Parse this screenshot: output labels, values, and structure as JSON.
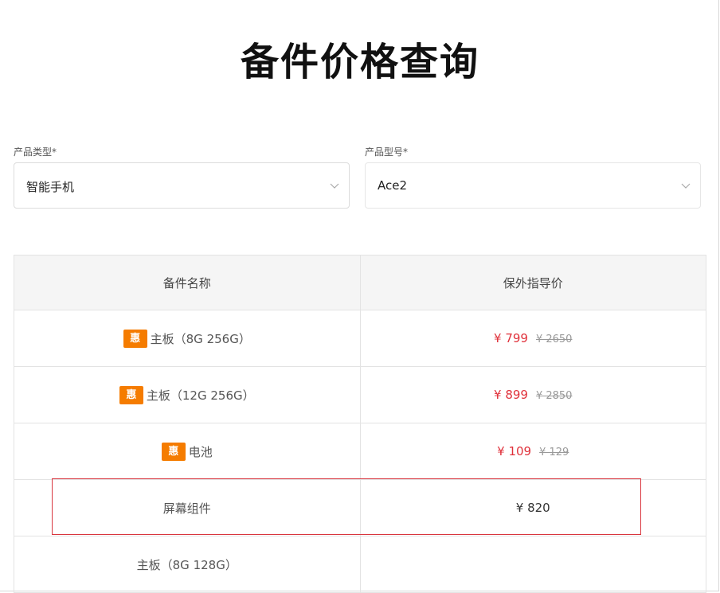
{
  "page": {
    "title": "备件价格查询"
  },
  "filters": {
    "product_type": {
      "label": "产品类型*",
      "value": "智能手机",
      "icon": "chevron-down-icon"
    },
    "product_model": {
      "label": "产品型号*",
      "value": "Ace2",
      "icon": "chevron-down-icon"
    }
  },
  "table": {
    "headers": [
      "备件名称",
      "保外指导价"
    ],
    "rows": [
      {
        "badge": "惠",
        "name": "主板（8G 256G）",
        "price": "¥ 799",
        "original_price": "¥ 2650"
      },
      {
        "badge": "惠",
        "name": "主板（12G 256G）",
        "price": "¥ 899",
        "original_price": "¥ 2850"
      },
      {
        "badge": "惠",
        "name": "电池",
        "price": "¥ 109",
        "original_price": "¥ 129"
      },
      {
        "badge": "",
        "name": "屏幕组件",
        "price": "¥ 820",
        "original_price": ""
      },
      {
        "badge": "",
        "name": "主板（8G 128G）",
        "price": "",
        "original_price": ""
      }
    ]
  },
  "colors": {
    "accent_badge": "#f57c00",
    "discount_price": "#e0313b",
    "highlight_border": "#d9363e"
  }
}
